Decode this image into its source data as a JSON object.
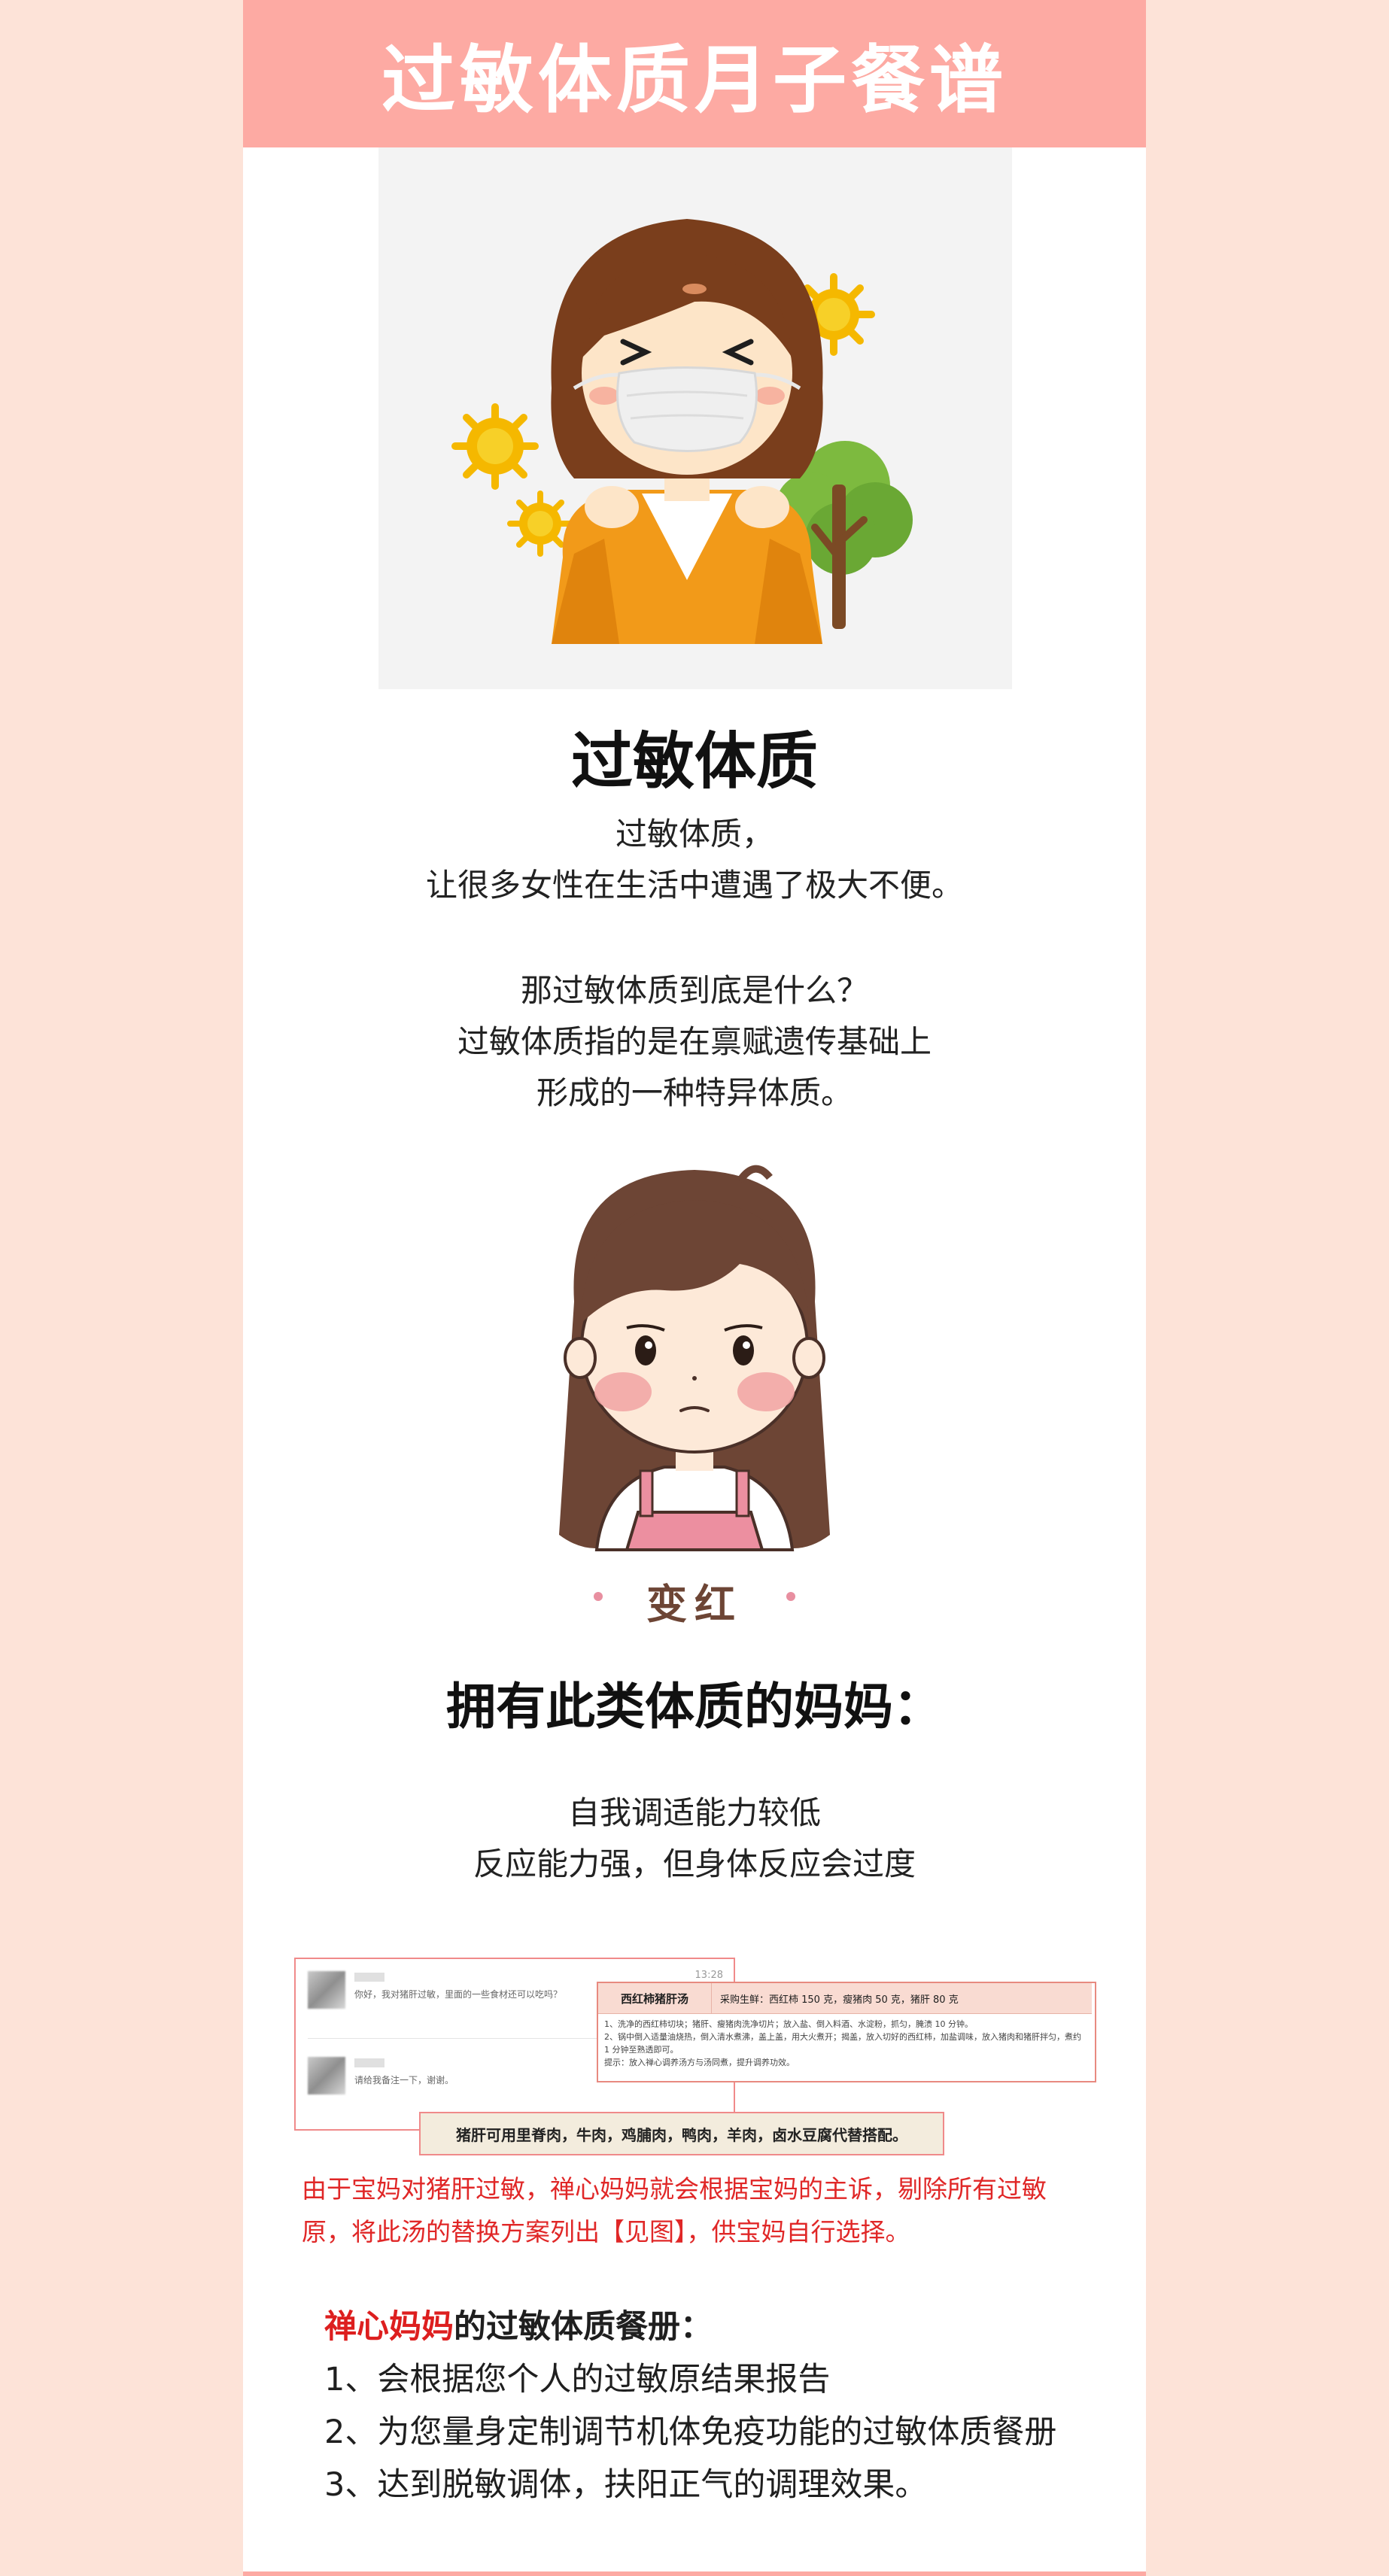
{
  "banner": {
    "title": "过敏体质月子餐谱"
  },
  "section1": {
    "heading": "过敏体质",
    "lines": [
      "过敏体质，",
      "让很多女性在生活中遭遇了极大不便。",
      "那过敏体质到底是什么？",
      "过敏体质指的是在禀赋遗传基础上",
      "形成的一种特异体质。"
    ]
  },
  "section2": {
    "illustration_label": "变红",
    "heading": "拥有此类体质的妈妈：",
    "lines": [
      "自我调适能力较低",
      "反应能力强，但身体反应会过度"
    ]
  },
  "chat": {
    "time": "13:28",
    "msg1": "你好，我对猪肝过敏，里面的一些食材还可以吃吗？",
    "msg2": "请给我备注一下，谢谢。"
  },
  "recipe": {
    "name": "西红柿猪肝汤",
    "ingredients": "采购生鲜：西红柿 150 克，瘦猪肉 50 克，猪肝 80 克",
    "steps": [
      "1、洗净的西红柿切块；猪肝、瘦猪肉洗净切片；放入盐、倒入料酒、水淀粉，抓匀，腌渍 10 分钟。",
      "2、锅中倒入适量油烧热，倒入清水煮沸，盖上盖，用大火煮开；揭盖，放入切好的西红柿，加盐调味，放入猪肉和猪肝拌匀，煮约 1 分钟至熟透即可。",
      "提示：放入禅心调养汤方与汤同煮，提升调养功效。"
    ]
  },
  "replacement_note": "猪肝可用里脊肉，牛肉，鸡脯肉，鸭肉，羊肉，卤水豆腐代替搭配。",
  "red_note": "由于宝妈对猪肝过敏，禅心妈妈就会根据宝妈的主诉，剔除所有过敏原，将此汤的替换方案列出【见图】，供宝妈自行选择。",
  "menu": {
    "brand": "禅心妈妈",
    "title_rest": "的过敏体质餐册：",
    "items": [
      "1、会根据您个人的过敏原结果报告",
      "2、为您量身定制调节机体免疫功能的过敏体质餐册",
      "3、达到脱敏调体，扶阳正气的调理效果。"
    ]
  },
  "colors": {
    "banner": "#fdaaa3",
    "background": "#fde3d8",
    "accent_red": "#e02727"
  }
}
